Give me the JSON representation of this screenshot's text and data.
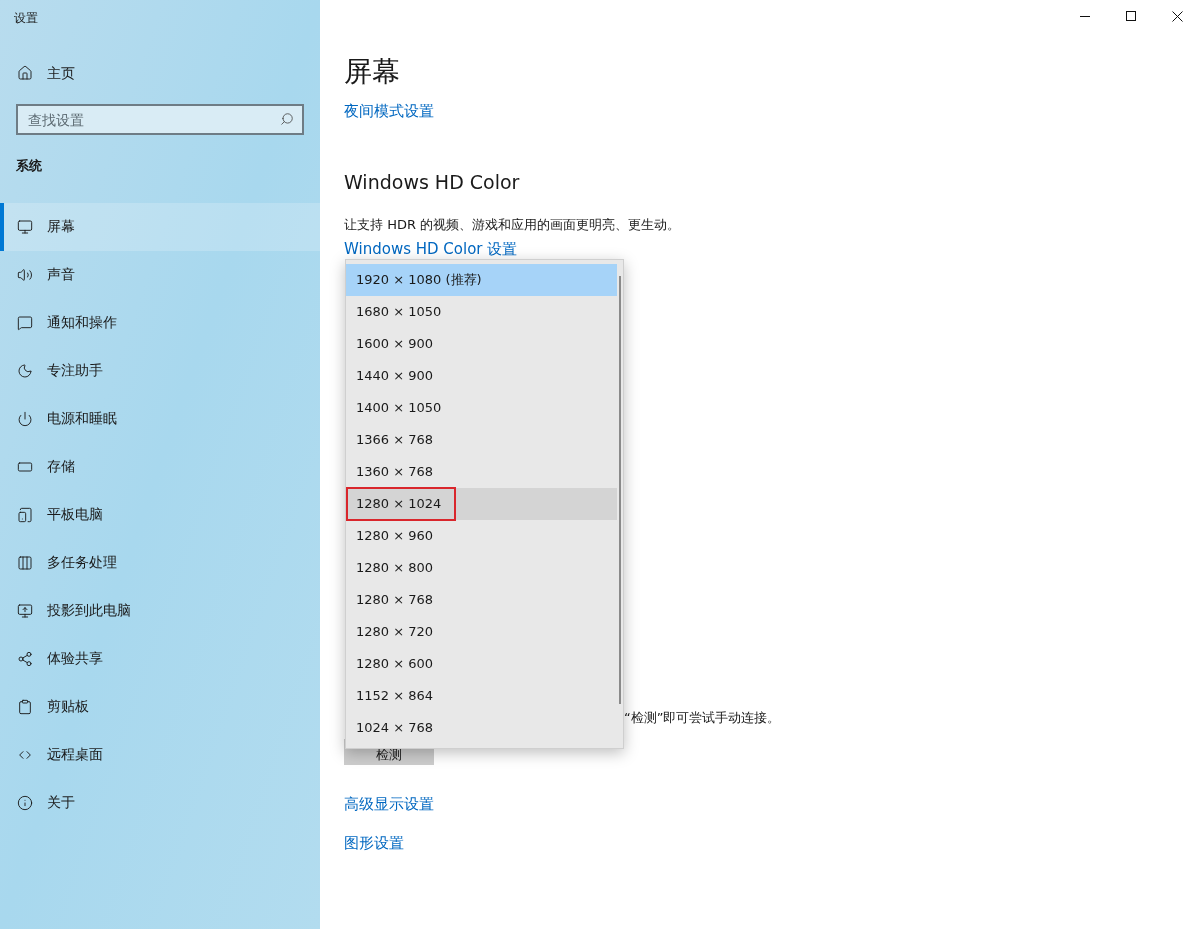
{
  "window": {
    "title": "设置"
  },
  "sidebar": {
    "home": "主页",
    "search": {
      "placeholder": "查找设置"
    },
    "section": "系统",
    "items": [
      {
        "label": "屏幕",
        "selected": true
      },
      {
        "label": "声音",
        "selected": false
      },
      {
        "label": "通知和操作",
        "selected": false
      },
      {
        "label": "专注助手",
        "selected": false
      },
      {
        "label": "电源和睡眠",
        "selected": false
      },
      {
        "label": "存储",
        "selected": false
      },
      {
        "label": "平板电脑",
        "selected": false
      },
      {
        "label": "多任务处理",
        "selected": false
      },
      {
        "label": "投影到此电脑",
        "selected": false
      },
      {
        "label": "体验共享",
        "selected": false
      },
      {
        "label": "剪贴板",
        "selected": false
      },
      {
        "label": "远程桌面",
        "selected": false
      },
      {
        "label": "关于",
        "selected": false
      }
    ]
  },
  "main": {
    "title": "屏幕",
    "night_link": "夜间模式设置",
    "hd_heading": "Windows HD Color",
    "hd_description": "让支持 HDR 的视频、游戏和应用的画面更明亮、更生动。",
    "hd_link": "Windows HD Color 设置",
    "detect_text": "“检测”即可尝试手动连接。",
    "detect_button": "检测",
    "advanced_link": "高级显示设置",
    "graphics_link": "图形设置"
  },
  "resolution_dropdown": {
    "options": [
      {
        "label": "1920 × 1080 (推荐)",
        "selected": true,
        "marked": false
      },
      {
        "label": "1680 × 1050",
        "selected": false,
        "marked": false
      },
      {
        "label": "1600 × 900",
        "selected": false,
        "marked": false
      },
      {
        "label": "1440 × 900",
        "selected": false,
        "marked": false
      },
      {
        "label": "1400 × 1050",
        "selected": false,
        "marked": false
      },
      {
        "label": "1366 × 768",
        "selected": false,
        "marked": false
      },
      {
        "label": "1360 × 768",
        "selected": false,
        "marked": false
      },
      {
        "label": "1280 × 1024",
        "selected": false,
        "marked": true
      },
      {
        "label": "1280 × 960",
        "selected": false,
        "marked": false
      },
      {
        "label": "1280 × 800",
        "selected": false,
        "marked": false
      },
      {
        "label": "1280 × 768",
        "selected": false,
        "marked": false
      },
      {
        "label": "1280 × 720",
        "selected": false,
        "marked": false
      },
      {
        "label": "1280 × 600",
        "selected": false,
        "marked": false
      },
      {
        "label": "1152 × 864",
        "selected": false,
        "marked": false
      },
      {
        "label": "1024 × 768",
        "selected": false,
        "marked": false
      }
    ]
  }
}
